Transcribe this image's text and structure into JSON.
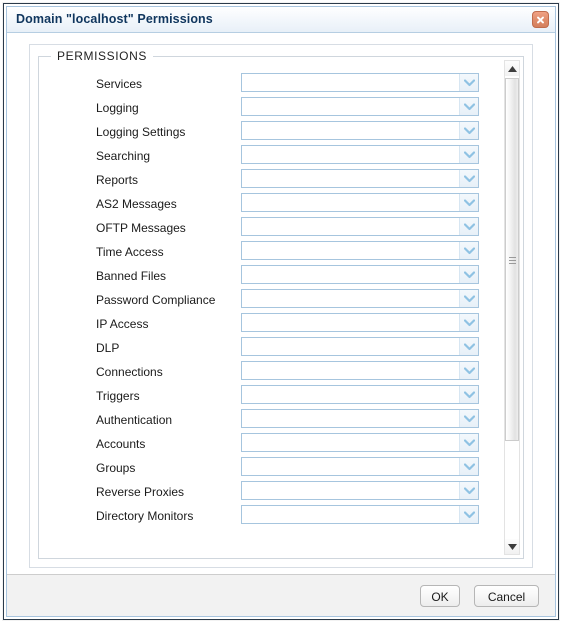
{
  "dialog": {
    "title": "Domain \"localhost\" Permissions",
    "close_icon": "close-icon"
  },
  "fieldset": {
    "legend": "PERMISSIONS"
  },
  "permissions": [
    {
      "label": "Services",
      "value": "",
      "dropdown_icon": "chevron-down-icon"
    },
    {
      "label": "Logging",
      "value": "",
      "dropdown_icon": "chevron-down-icon"
    },
    {
      "label": "Logging Settings",
      "value": "",
      "dropdown_icon": "chevron-down-icon"
    },
    {
      "label": "Searching",
      "value": "",
      "dropdown_icon": "chevron-down-icon"
    },
    {
      "label": "Reports",
      "value": "",
      "dropdown_icon": "chevron-down-icon"
    },
    {
      "label": "AS2 Messages",
      "value": "",
      "dropdown_icon": "chevron-down-icon"
    },
    {
      "label": "OFTP Messages",
      "value": "",
      "dropdown_icon": "chevron-down-icon"
    },
    {
      "label": "Time Access",
      "value": "",
      "dropdown_icon": "chevron-down-icon"
    },
    {
      "label": "Banned Files",
      "value": "",
      "dropdown_icon": "chevron-down-icon"
    },
    {
      "label": "Password Compliance",
      "value": "",
      "dropdown_icon": "chevron-down-icon"
    },
    {
      "label": "IP Access",
      "value": "",
      "dropdown_icon": "chevron-down-icon"
    },
    {
      "label": "DLP",
      "value": "",
      "dropdown_icon": "chevron-down-icon"
    },
    {
      "label": "Connections",
      "value": "",
      "dropdown_icon": "chevron-down-icon"
    },
    {
      "label": "Triggers",
      "value": "",
      "dropdown_icon": "chevron-down-icon"
    },
    {
      "label": "Authentication",
      "value": "",
      "dropdown_icon": "chevron-down-icon"
    },
    {
      "label": "Accounts",
      "value": "",
      "dropdown_icon": "chevron-down-icon"
    },
    {
      "label": "Groups",
      "value": "",
      "dropdown_icon": "chevron-down-icon"
    },
    {
      "label": "Reverse Proxies",
      "value": "",
      "dropdown_icon": "chevron-down-icon"
    },
    {
      "label": "Directory Monitors",
      "value": "",
      "dropdown_icon": "chevron-down-icon"
    }
  ],
  "scrollbar": {
    "up_icon": "scroll-up-arrow-icon",
    "down_icon": "scroll-down-arrow-icon",
    "grip_icon": "scrollbar-grip-icon"
  },
  "footer": {
    "ok_label": "OK",
    "cancel_label": "Cancel"
  },
  "colors": {
    "title_text": "#10365e",
    "close_button": "#e08d6c",
    "select_border": "#a6c5de",
    "chevron": "#8fc2e3",
    "panel_border": "#d7dde4",
    "window_border": "#2b3a4a",
    "footer_bg": "#f2f2f2"
  }
}
